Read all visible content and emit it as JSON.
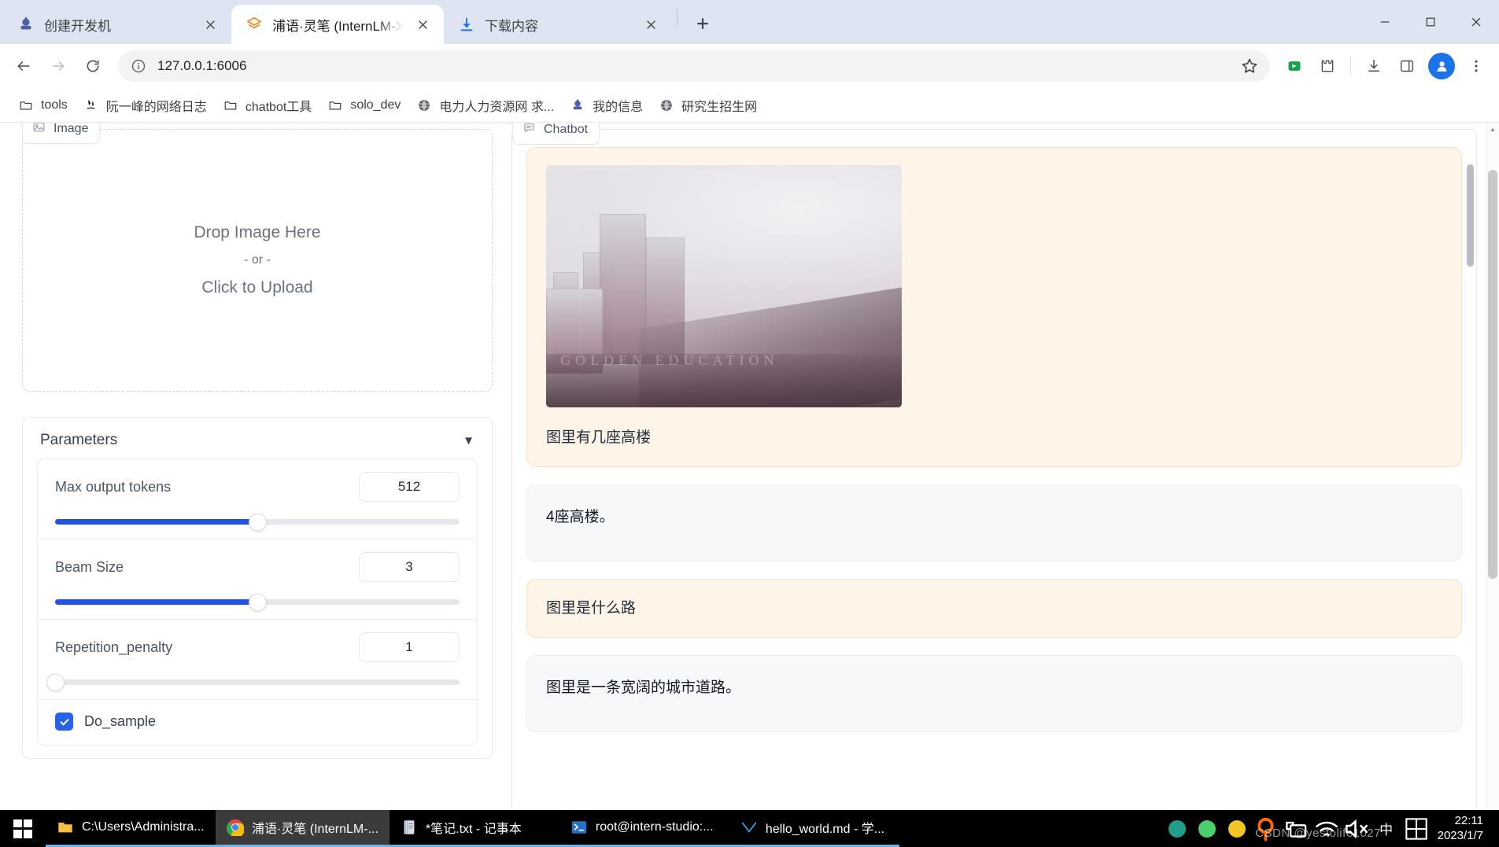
{
  "browser": {
    "tabs": [
      {
        "title": "创建开发机",
        "favicon": "dev-machine-icon",
        "active": false
      },
      {
        "title": "浦语·灵笔 (InternLM-XCompo",
        "favicon": "internlm-icon",
        "active": true
      },
      {
        "title": "下载内容",
        "favicon": "download-icon",
        "active": false
      }
    ],
    "new_tab_label": "+",
    "window_controls": {
      "minimize": "—",
      "maximize": "▢",
      "close": "✕"
    },
    "toolbar": {
      "back": "←",
      "forward": "→",
      "reload": "⟳",
      "url": "127.0.0.1:6006",
      "info_icon": "site-info-icon",
      "bookmark_icon": "star-icon",
      "extensions_icon": "puzzle-icon",
      "downloads_icon": "download-icon",
      "sidepanel_icon": "side-panel-icon",
      "profile_icon": "profile-avatar-icon",
      "menu_icon": "three-dot-menu-icon"
    },
    "bookmarks": [
      {
        "label": "tools",
        "icon": "folder-icon"
      },
      {
        "label": "阮一峰的网络日志",
        "icon": "book-icon"
      },
      {
        "label": "chatbot工具",
        "icon": "folder-icon"
      },
      {
        "label": "solo_dev",
        "icon": "folder-icon"
      },
      {
        "label": "电力人力资源网 求...",
        "icon": "globe-icon"
      },
      {
        "label": "我的信息",
        "icon": "avatar-icon"
      },
      {
        "label": "研究生招生网",
        "icon": "globe-icon"
      }
    ]
  },
  "app": {
    "image_panel": {
      "label": "Image",
      "label_icon": "image-icon",
      "drop_primary": "Drop Image Here",
      "drop_or": "- or -",
      "drop_click": "Click to Upload"
    },
    "parameters": {
      "title": "Parameters",
      "collapse_caret": "▼",
      "sliders": [
        {
          "name": "Max output tokens",
          "value": "512",
          "fill_percent": 50
        },
        {
          "name": "Beam Size",
          "value": "3",
          "fill_percent": 50
        },
        {
          "name": "Repetition_penalty",
          "value": "1",
          "fill_percent": 0
        }
      ],
      "checkbox": {
        "label": "Do_sample",
        "checked": true,
        "check_glyph": "✓"
      }
    },
    "chatbot": {
      "label": "Chatbot",
      "label_icon": "chat-bubble-icon",
      "messages": [
        {
          "role": "user",
          "has_image": true,
          "image_alt": "foggy city skyline with high-rise buildings and a wide road",
          "image_watermark": "GOLDEN EDUCATION",
          "text": "图里有几座高楼"
        },
        {
          "role": "bot",
          "has_image": false,
          "text": "4座高楼。"
        },
        {
          "role": "user",
          "has_image": false,
          "text": "图里是什么路"
        },
        {
          "role": "bot",
          "has_image": false,
          "text": "图里是一条宽阔的城市道路。"
        }
      ]
    }
  },
  "taskbar": {
    "start_label": "start-button",
    "tasks": [
      {
        "label": "C:\\Users\\Administra...",
        "icon": "folder-icon",
        "active": false
      },
      {
        "label": "浦语·灵笔 (InternLM-...",
        "icon": "chrome-icon",
        "active": true
      },
      {
        "label": "*笔记.txt - 记事本",
        "icon": "notepad-icon",
        "active": false
      },
      {
        "label": "root@intern-studio:...",
        "icon": "terminal-icon",
        "active": false
      },
      {
        "label": "hello_world.md - 学...",
        "icon": "typora-icon",
        "active": false
      }
    ],
    "tray": [
      {
        "name": "app-green-icon",
        "glyph": "●",
        "color": "#1f9e8b"
      },
      {
        "name": "wechat-icon",
        "glyph": "●",
        "color": "#4ccf6d"
      },
      {
        "name": "app-yellow-icon",
        "glyph": "●",
        "color": "#f3c623"
      },
      {
        "name": "search-icon",
        "glyph": "🔍",
        "color": "#ff6a00"
      },
      {
        "name": "usb-icon",
        "glyph": "⌸",
        "color": "#ffffff"
      },
      {
        "name": "wifi-icon",
        "glyph": "◞",
        "color": "#ffffff"
      },
      {
        "name": "volume-mute-icon",
        "glyph": "◁",
        "color": "#ffffff"
      },
      {
        "name": "ime-chinese-icon",
        "glyph": "中",
        "color": "#ffffff"
      },
      {
        "name": "ime-panel-icon",
        "glyph": "▦",
        "color": "#ffffff"
      }
    ],
    "clock": {
      "time": "22:11",
      "date": "2023/1/7"
    },
    "watermark": "CSDN @yestolife1027"
  },
  "colors": {
    "tabstrip_bg": "#dee4f2",
    "slider_fill": "#1f53e0",
    "checkbox": "#2563eb",
    "user_msg_bg": "#fef5e8",
    "bot_msg_bg": "#f7f8fa",
    "taskbar_bg": "#000000",
    "task_underline": "#69b4e8"
  }
}
